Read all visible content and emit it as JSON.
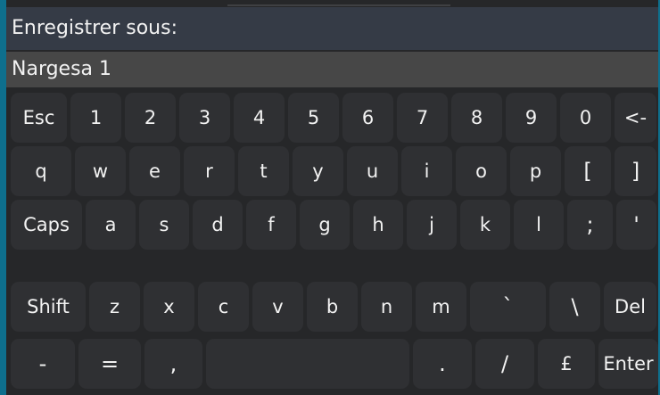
{
  "dialog": {
    "title": "Enregistrer sous:",
    "filename_value": "Nargesa 1"
  },
  "keyboard": {
    "row1": [
      "Esc",
      "1",
      "2",
      "3",
      "4",
      "5",
      "6",
      "7",
      "8",
      "9",
      "0",
      "<-"
    ],
    "row2": [
      "q",
      "w",
      "e",
      "r",
      "t",
      "y",
      "u",
      "i",
      "o",
      "p",
      "[",
      "]"
    ],
    "row3": [
      "Caps",
      "a",
      "s",
      "d",
      "f",
      "g",
      "h",
      "j",
      "k",
      "l",
      ";",
      "'"
    ],
    "row4": [
      "Shift",
      "z",
      "x",
      "c",
      "v",
      "b",
      "n",
      "m",
      "`",
      "\\",
      "Del"
    ],
    "row5": [
      "-",
      "=",
      ",",
      "",
      ".",
      "/",
      "£",
      "Enter"
    ]
  }
}
